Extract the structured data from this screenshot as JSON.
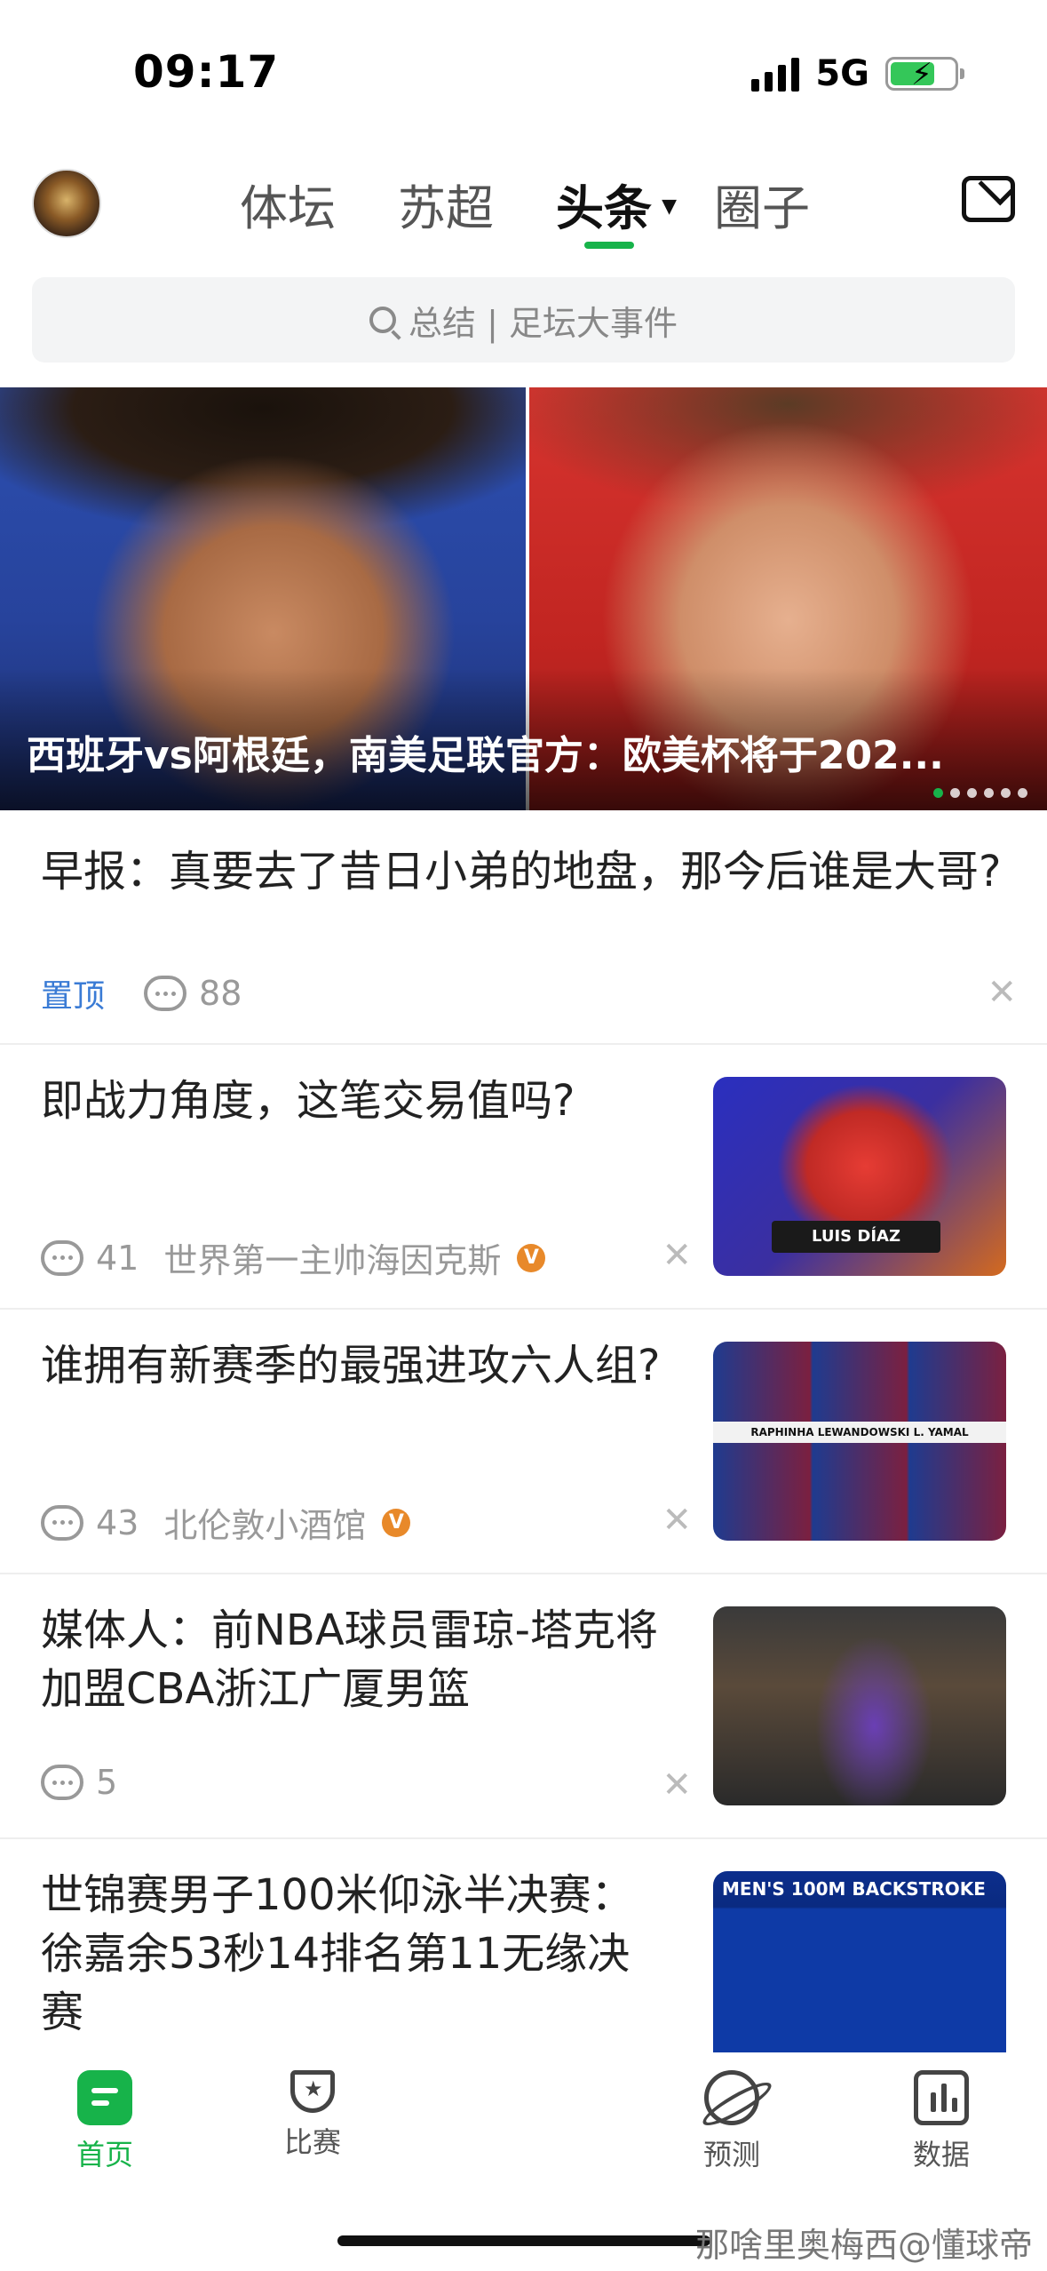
{
  "status_bar": {
    "time": "09:17",
    "network": "5G"
  },
  "header": {
    "tabs": [
      {
        "label": "体坛"
      },
      {
        "label": "苏超"
      },
      {
        "label": "头条",
        "active": true
      },
      {
        "label": "圈子"
      }
    ]
  },
  "search": {
    "placeholder": "总结 | 足坛大事件"
  },
  "banner": {
    "title": "西班牙vs阿根廷，南美足联官方：欧美杯将于202...",
    "page_count": 6,
    "active_page": 1
  },
  "feed": {
    "pinned": {
      "title": "早报：真要去了昔日小弟的地盘，那今后谁是大哥?",
      "tag": "置顶",
      "comments": "88"
    },
    "items": [
      {
        "title": "即战力角度，这笔交易值吗?",
        "comments": "41",
        "source": "世界第一主帅海因克斯",
        "verified": "V",
        "thumb_caption": "LUIS DÍAZ"
      },
      {
        "title": "谁拥有新赛季的最强进攻六人组?",
        "comments": "43",
        "source": "北伦敦小酒馆",
        "verified": "V",
        "thumb_caption": "RAPHINHA LEWANDOWSKI L. YAMAL"
      },
      {
        "title": "媒体人：前NBA球员雷琼-塔克将加盟CBA浙江广厦男篮",
        "comments": "5",
        "source": ""
      },
      {
        "title": "世锦赛男子100米仰泳半决赛：徐嘉余53秒14排名第11无缘决赛",
        "thumb_caption": "MEN'S 100M BACKSTROKE"
      }
    ]
  },
  "tabbar": {
    "items": [
      {
        "label": "首页",
        "icon": "home-icon",
        "active": true
      },
      {
        "label": "比赛",
        "icon": "trophy-icon"
      },
      {
        "label": "预测",
        "icon": "planet-icon"
      },
      {
        "label": "数据",
        "icon": "bar-chart-icon"
      }
    ]
  },
  "watermark": "那啥里奥梅西@懂球帝",
  "colors": {
    "accent": "#17b34a",
    "pin": "#3a7bd5",
    "verified": "#e8892a"
  }
}
